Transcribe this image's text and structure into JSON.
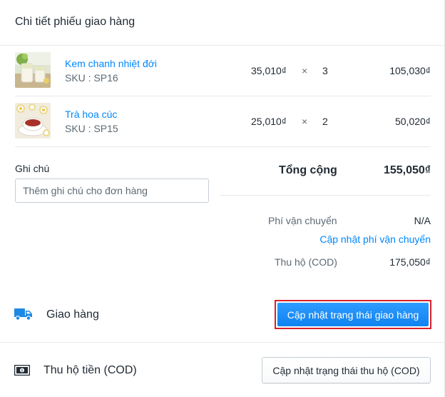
{
  "panel": {
    "title": "Chi tiết phiếu giao hàng"
  },
  "items": [
    {
      "name": "Kem chanh nhiệt đới",
      "sku": "SKU : SP16",
      "price": "35,010₫",
      "times": "×",
      "quantity": "3",
      "line_total": "105,030₫"
    },
    {
      "name": "Trà hoa cúc",
      "sku": "SKU : SP15",
      "price": "25,010₫",
      "times": "×",
      "quantity": "2",
      "line_total": "50,020₫"
    }
  ],
  "note": {
    "label": "Ghi chú",
    "placeholder": "Thêm ghi chú cho đơn hàng",
    "value": ""
  },
  "summary": {
    "total_label": "Tổng cộng",
    "total_value": "155,050₫",
    "shipping_label": "Phí vận chuyển",
    "shipping_value": "N/A",
    "update_shipping_link": "Cập nhật phí vận chuyển",
    "cod_label": "Thu hộ (COD)",
    "cod_value": "175,050₫"
  },
  "delivery": {
    "label": "Giao hàng",
    "button": "Cập nhật trạng thái giao hàng",
    "icon": "truck-icon"
  },
  "cod_section": {
    "label": "Thu hộ tiền (COD)",
    "button": "Cập nhật trạng thái thu hộ (COD)",
    "icon": "cash-icon"
  },
  "colors": {
    "link": "#0088ff",
    "primary_button": "#1a8df7",
    "highlight_border": "#d9202b",
    "icon_blue": "#1e88e5"
  }
}
